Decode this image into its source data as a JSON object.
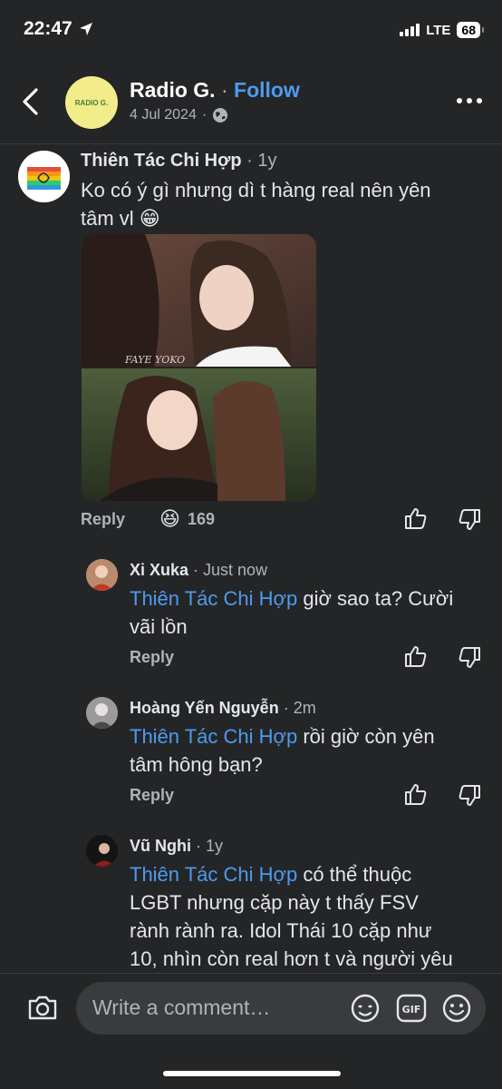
{
  "status": {
    "time": "22:47",
    "network": "LTE",
    "battery": "68"
  },
  "header": {
    "page_name": "Radio G.",
    "separator": "·",
    "follow_label": "Follow",
    "date": "4 Jul 2024",
    "avatar_text": "RADIO G."
  },
  "comments": [
    {
      "author": "Thiên Tác Chi Hợp",
      "time": "1y",
      "text_line1": "Ko có ý gì nhưng dì t hàng real nên yên",
      "text_line2": "tâm vl 😁",
      "reply_label": "Reply",
      "reaction_emoji": "😆",
      "reaction_count": "169",
      "image_watermark": "FAYE YOKO"
    }
  ],
  "replies": [
    {
      "author": "Xi Xuka",
      "time": "Just now",
      "mention": "Thiên Tác Chi Hợp",
      "text_line1": " giờ sao ta? Cười",
      "text_line2": "vãi lồn",
      "reply_label": "Reply"
    },
    {
      "author": "Hoàng Yến Nguyễn",
      "time": "2m",
      "mention": "Thiên Tác Chi Hợp",
      "text_line1": " rồi giờ còn yên",
      "text_line2": "tâm hông bạn?",
      "reply_label": "Reply"
    },
    {
      "author": "Vũ Nghi",
      "time": "1y",
      "mention": "Thiên Tác Chi Hợp",
      "text_line1": " có thể thuộc",
      "text_line2": "LGBT nhưng cặp này t thấy FSV",
      "text_line3": "rành rành ra. Idol Thái 10 cặp như",
      "text_line4": "10, nhìn còn real hơn t và người yêu"
    }
  ],
  "composer": {
    "placeholder": "Write a comment…"
  },
  "time_sep": " · "
}
